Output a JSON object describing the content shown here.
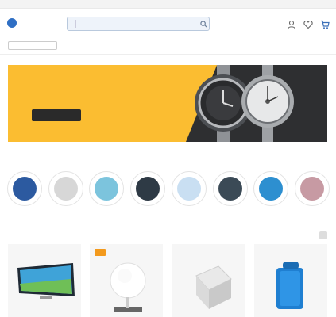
{
  "topbar": {
    "left_text": "",
    "right_links": [
      "",
      "",
      ""
    ]
  },
  "header": {
    "logo": "",
    "search": {
      "category": "",
      "placeholder": ""
    },
    "account_text": "",
    "icons": [
      "user-icon",
      "heart-icon",
      "cart-icon"
    ]
  },
  "nav": {
    "all_categories": "",
    "links": [
      "",
      "",
      "",
      "",
      "",
      ""
    ],
    "active_index": 1,
    "right": [
      "",
      ""
    ]
  },
  "breadcrumb": "",
  "banner": {
    "eyebrow": "",
    "headline": "",
    "cta": "",
    "colors": {
      "background": "#fbbd31",
      "dark": "#2e2f31"
    }
  },
  "brands": [
    "",
    "",
    "",
    "",
    "",
    "",
    "",
    ""
  ],
  "categories": [
    {
      "label": "",
      "color": "#2c5aa0"
    },
    {
      "label": "",
      "color": "#d7d7d7"
    },
    {
      "label": "",
      "color": "#7cc4dd"
    },
    {
      "label": "",
      "color": "#2e3a45"
    },
    {
      "label": "",
      "color": "#c9dff2"
    },
    {
      "label": "",
      "color": "#3b4a56"
    },
    {
      "label": "",
      "color": "#2d8fd0"
    },
    {
      "label": "",
      "color": "#c79aa3"
    }
  ],
  "product_tabs": [
    "",
    "",
    "",
    "",
    "",
    ""
  ],
  "pager": {
    "label": ""
  },
  "products": [
    {
      "name": "tv",
      "badge": false
    },
    {
      "name": "lamp",
      "badge": true
    },
    {
      "name": "box",
      "badge": false
    },
    {
      "name": "speaker",
      "badge": false
    }
  ]
}
